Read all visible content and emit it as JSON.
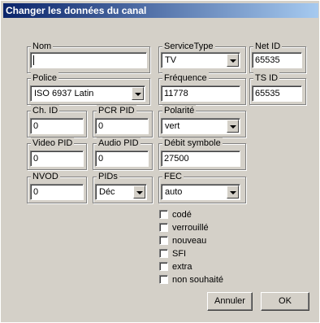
{
  "window": {
    "title": "Changer les données du canal"
  },
  "fields": {
    "nom": {
      "label": "Nom",
      "value": ""
    },
    "service_type": {
      "label": "ServiceType",
      "value": "TV"
    },
    "net_id": {
      "label": "Net ID",
      "value": "65535"
    },
    "police": {
      "label": "Police",
      "value": "ISO 6937 Latin"
    },
    "frequence": {
      "label": "Fréquence",
      "value": "11778"
    },
    "ts_id": {
      "label": "TS ID",
      "value": "65535"
    },
    "ch_id": {
      "label": "Ch. ID",
      "value": "0"
    },
    "pcr_pid": {
      "label": "PCR PID",
      "value": "0"
    },
    "polarite": {
      "label": "Polarité",
      "value": "vert"
    },
    "video_pid": {
      "label": "Video PID",
      "value": "0"
    },
    "audio_pid": {
      "label": "Audio PID",
      "value": "0"
    },
    "debit_symbole": {
      "label": "Débit symbole",
      "value": "27500"
    },
    "nvod": {
      "label": "NVOD",
      "value": "0"
    },
    "pids": {
      "label": "PIDs",
      "value": "Déc"
    },
    "fec": {
      "label": "FEC",
      "value": "auto"
    }
  },
  "checkboxes": [
    {
      "label": "codé",
      "checked": false
    },
    {
      "label": "verrouillé",
      "checked": false
    },
    {
      "label": "nouveau",
      "checked": false
    },
    {
      "label": "SFI",
      "checked": false
    },
    {
      "label": "extra",
      "checked": false
    },
    {
      "label": "non souhaité",
      "checked": false
    }
  ],
  "buttons": {
    "cancel": "Annuler",
    "ok": "OK"
  },
  "colors": {
    "titlebar_start": "#0a246a",
    "titlebar_end": "#a6caf0",
    "face": "#d4d0c8"
  }
}
